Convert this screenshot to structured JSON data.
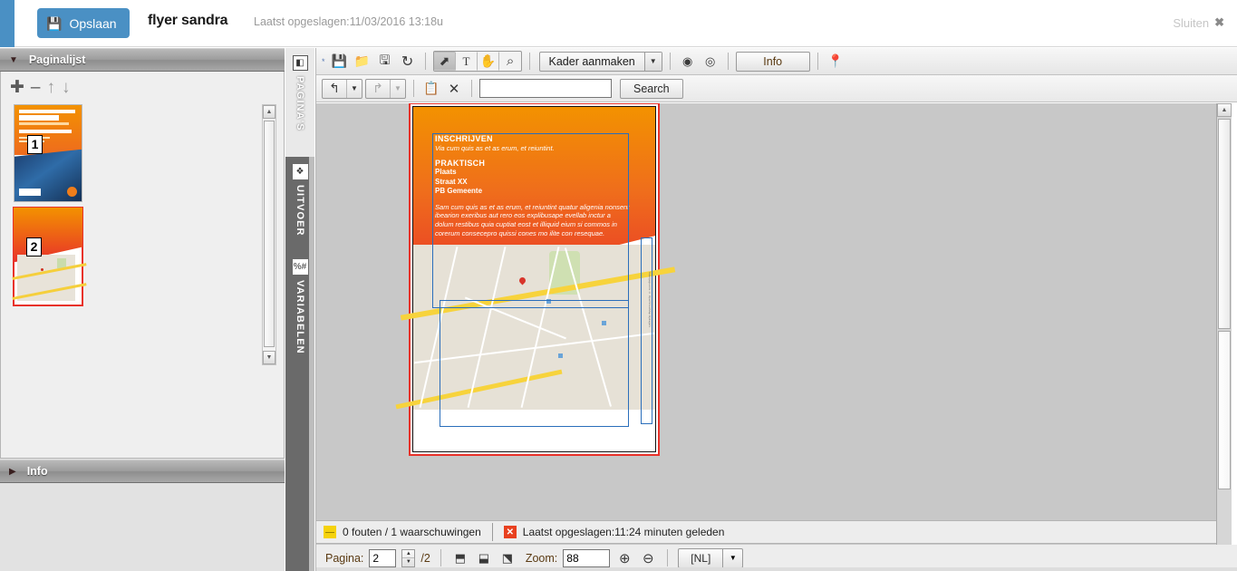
{
  "header": {
    "save_label": "Opslaan",
    "save_icon": "floppy-disk-icon",
    "doc_title": "flyer sandra",
    "saved_info": "Laatst opgeslagen:11/03/2016 13:18u",
    "close_label": "Sluiten",
    "close_icon": "close-x-icon",
    "accent_color": "#4a90c4"
  },
  "sidebar": {
    "pagelist_title": "Paginalijst",
    "pagelist_collapse_icon": "triangle-down-icon",
    "tools": [
      {
        "name": "add-page-button",
        "glyph": "✚"
      },
      {
        "name": "remove-page-button",
        "glyph": "‒"
      },
      {
        "name": "move-page-up-button",
        "glyph": "↑"
      },
      {
        "name": "move-page-down-button",
        "glyph": "↓"
      }
    ],
    "pages": [
      {
        "number": "1",
        "selected": false
      },
      {
        "number": "2",
        "selected": true
      }
    ],
    "info_title": "Info",
    "info_expand_icon": "triangle-right-icon"
  },
  "rail": {
    "tabs": [
      {
        "label": "PAGINA'S",
        "icon": "pages-icon",
        "glyph": "◧",
        "active": true
      },
      {
        "label": "UITVOER",
        "icon": "output-icon",
        "glyph": "❖",
        "active": false
      },
      {
        "label": "VARIABELEN",
        "icon": "variables-icon",
        "glyph": "%#",
        "active": false
      }
    ]
  },
  "toolbar": {
    "row1": {
      "asterisk": "*",
      "file_buttons": [
        {
          "name": "save-doc-icon",
          "glyph": "💾"
        },
        {
          "name": "open-folder-icon",
          "glyph": "📁"
        },
        {
          "name": "save-as-icon",
          "glyph": "🖫"
        },
        {
          "name": "refresh-icon",
          "glyph": "↻"
        }
      ],
      "mode_buttons": [
        {
          "name": "select-tool",
          "glyph": "⬈",
          "active": true
        },
        {
          "name": "text-tool",
          "glyph": "T",
          "active": false
        },
        {
          "name": "hand-tool",
          "glyph": "✋",
          "active": false
        },
        {
          "name": "zoom-tool",
          "glyph": "⌕",
          "active": false
        }
      ],
      "frame_dropdown": "Kader aanmaken",
      "frame_dropdown_arrow_icon": "chevron-down-icon",
      "view_buttons": [
        {
          "name": "preview-eye-icon",
          "glyph": "◉"
        },
        {
          "name": "target-icon",
          "glyph": "◎"
        }
      ],
      "info_button": "Info",
      "pin_icon": "map-pin-icon"
    },
    "row2": {
      "undo_icon": "undo-icon",
      "undo_arrow_icon": "chevron-down-icon",
      "redo_icon": "redo-icon",
      "redo_arrow_icon": "chevron-down-icon",
      "copy_icon": "copy-pages-icon",
      "clean_icon": "clear-formatting-icon",
      "search_value": "",
      "search_placeholder": "",
      "search_button": "Search"
    }
  },
  "document": {
    "heading1": "INSCHRIJVEN",
    "subtitle1": "Via cum quis as et as erum, et reiuntint.",
    "heading2": "PRAKTISCH",
    "address_line1": "Plaats",
    "address_line2": "Straat XX",
    "address_line3": "PB Gemeente",
    "body": "Sam cum quis as et as erum, et reiuntint quatur aligenia nonsent ibearion exeribus aut rero eos explibusape evellab inctur a dolum restibus quia cuptiat eost et illiquid eium si commos in corerum consecepro quissi cones mo ilite con resequae.",
    "map_credit": "Kaartgegevens © OpenStreetMap bijdragers",
    "colors": {
      "gradient_start": "#f39200",
      "gradient_end": "#e8322a",
      "frame_border": "#2a6ebb",
      "page_border": "#e8322a"
    }
  },
  "status": {
    "warn_icon": "warning-square-icon",
    "warn_text": "0 fouten / 1 waarschuwingen",
    "error_icon": "error-square-icon",
    "error_text": "Laatst opgeslagen:11:24 minuten geleden",
    "warn_color": "#f5d20c",
    "error_color": "#e8401f"
  },
  "bottombar": {
    "page_label": "Pagina:",
    "page_value": "2",
    "page_total": "/2",
    "spin_up_icon": "spinner-up-icon",
    "spin_down_icon": "spinner-down-icon",
    "page_icons": [
      {
        "name": "insert-page-icon",
        "glyph": "◨"
      },
      {
        "name": "duplicate-page-icon",
        "glyph": "▧"
      },
      {
        "name": "delete-page-icon",
        "glyph": "▨"
      }
    ],
    "zoom_label": "Zoom:",
    "zoom_value": "88",
    "zoom_in_icon": "zoom-in-icon",
    "zoom_out_icon": "zoom-out-icon",
    "language_value": "[NL]",
    "language_arrow_icon": "chevron-down-icon"
  }
}
